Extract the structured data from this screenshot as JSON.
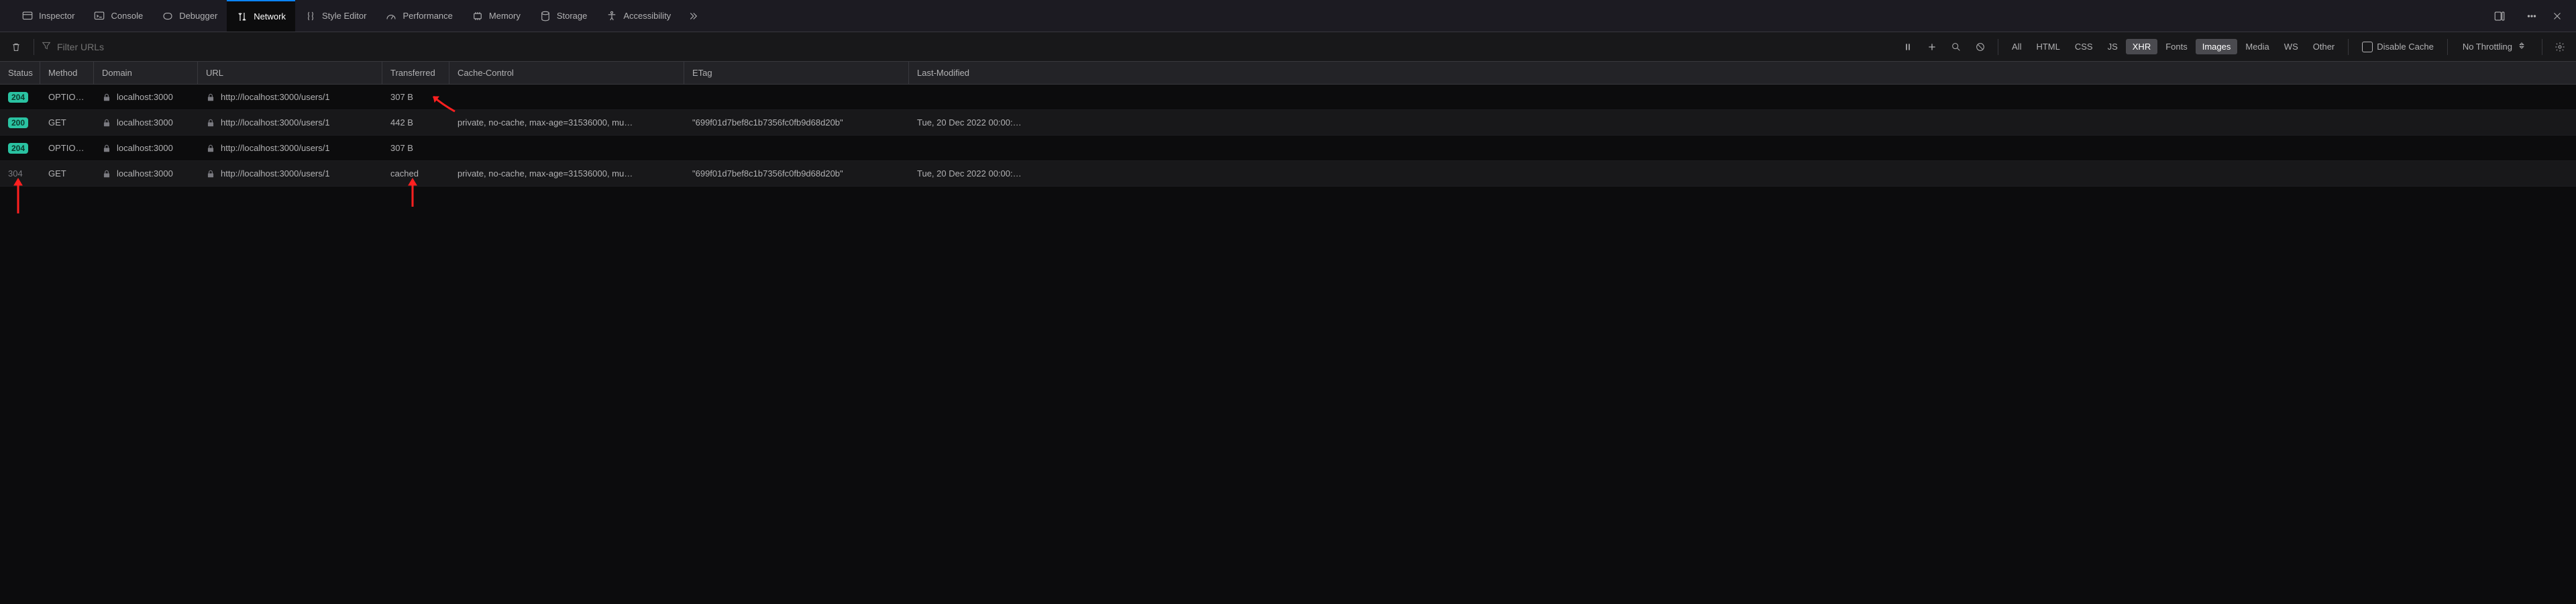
{
  "tabs": [
    {
      "label": "Inspector",
      "icon": "inspector"
    },
    {
      "label": "Console",
      "icon": "console"
    },
    {
      "label": "Debugger",
      "icon": "debugger"
    },
    {
      "label": "Network",
      "icon": "network",
      "active": true
    },
    {
      "label": "Style Editor",
      "icon": "style"
    },
    {
      "label": "Performance",
      "icon": "performance"
    },
    {
      "label": "Memory",
      "icon": "memory"
    },
    {
      "label": "Storage",
      "icon": "storage"
    },
    {
      "label": "Accessibility",
      "icon": "accessibility"
    }
  ],
  "toolbar": {
    "filter_placeholder": "Filter URLs",
    "filters": [
      "All",
      "HTML",
      "CSS",
      "JS",
      "XHR",
      "Fonts",
      "Images",
      "Media",
      "WS",
      "Other"
    ],
    "filters_selected": [
      "XHR",
      "Images"
    ],
    "disable_cache_label": "Disable Cache",
    "throttling_label": "No Throttling"
  },
  "columns": [
    "Status",
    "Method",
    "Domain",
    "URL",
    "Transferred",
    "Cache-Control",
    "ETag",
    "Last-Modified"
  ],
  "rows": [
    {
      "status": "204",
      "status_class": "2xx",
      "method": "OPTIO…",
      "domain": "localhost:3000",
      "url": "http://localhost:3000/users/1",
      "transferred": "307 B",
      "cache": "",
      "etag": "",
      "lastmod": ""
    },
    {
      "status": "200",
      "status_class": "2xx",
      "method": "GET",
      "domain": "localhost:3000",
      "url": "http://localhost:3000/users/1",
      "transferred": "442 B",
      "cache": "private, no-cache, max-age=31536000, mu…",
      "etag": "\"699f01d7bef8c1b7356fc0fb9d68d20b\"",
      "lastmod": "Tue, 20 Dec 2022 00:00:…"
    },
    {
      "status": "204",
      "status_class": "2xx",
      "method": "OPTIO…",
      "domain": "localhost:3000",
      "url": "http://localhost:3000/users/1",
      "transferred": "307 B",
      "cache": "",
      "etag": "",
      "lastmod": ""
    },
    {
      "status": "304",
      "status_class": "3xx",
      "method": "GET",
      "domain": "localhost:3000",
      "url": "http://localhost:3000/users/1",
      "transferred": "cached",
      "cache": "private, no-cache, max-age=31536000, mu…",
      "etag": "\"699f01d7bef8c1b7356fc0fb9d68d20b\"",
      "lastmod": "Tue, 20 Dec 2022 00:00:…"
    }
  ]
}
